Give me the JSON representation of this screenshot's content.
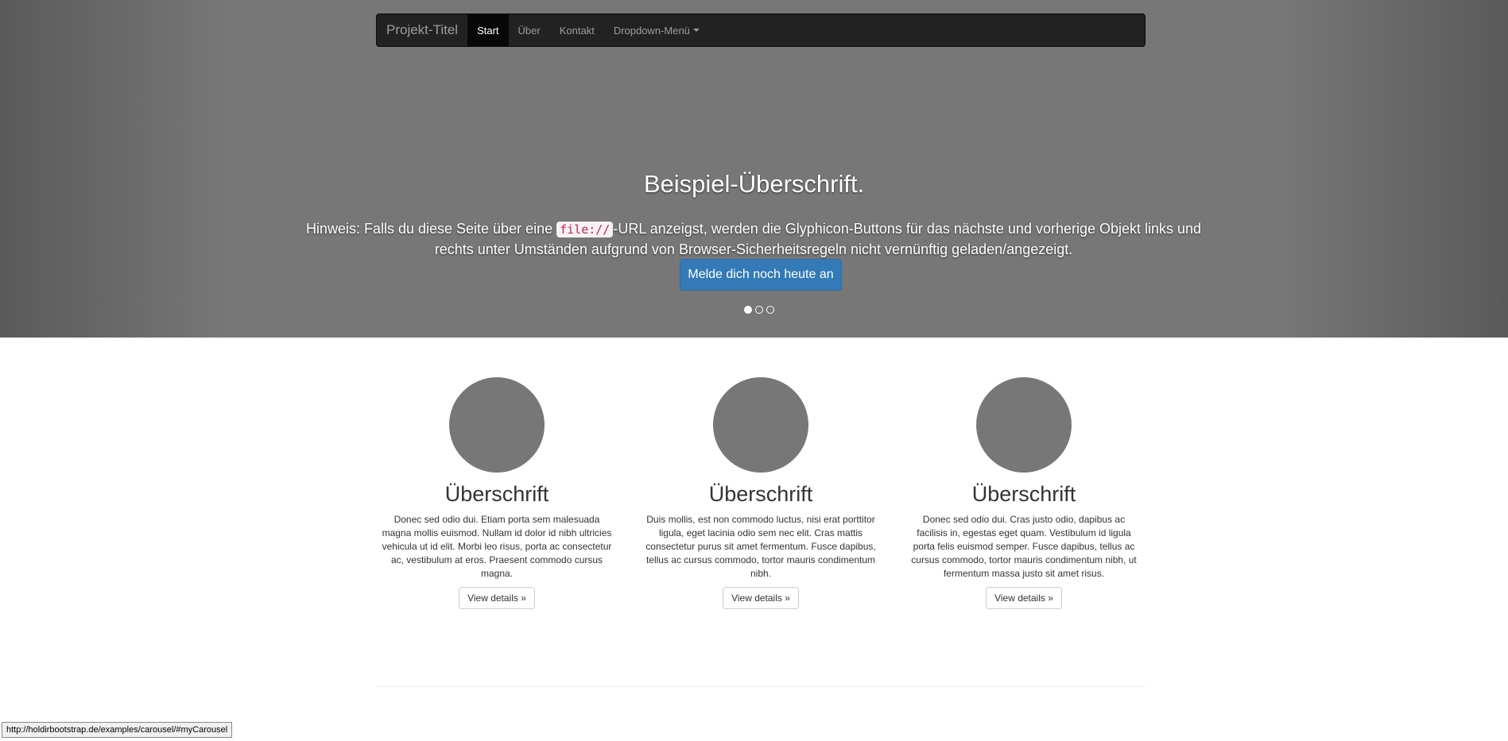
{
  "navbar": {
    "brand": "Projekt-Titel",
    "items": [
      {
        "label": "Start",
        "active": true
      },
      {
        "label": "Über",
        "active": false
      },
      {
        "label": "Kontakt",
        "active": false
      },
      {
        "label": "Dropdown-Menü",
        "active": false
      }
    ]
  },
  "carousel": {
    "title": "Beispiel-Überschrift.",
    "text_before": "Hinweis: Falls du diese Seite über eine ",
    "code": "file://",
    "text_after": "-URL anzeigst, werden die Glyphicon-Buttons für das nächste und vorherige Objekt links und rechts unter Umständen aufgrund von Browser-Sicherheitsregeln nicht vernünftig geladen/angezeigt.",
    "button_label": "Melde dich noch heute an",
    "slide_count": 3,
    "active_slide": 1
  },
  "columns": [
    {
      "heading": "Überschrift",
      "text": "Donec sed odio dui. Etiam porta sem malesuada magna mollis euismod. Nullam id dolor id nibh ultricies vehicula ut id elit. Morbi leo risus, porta ac consectetur ac, vestibulum at eros. Praesent commodo cursus magna.",
      "button_label": "View details »"
    },
    {
      "heading": "Überschrift",
      "text": "Duis mollis, est non commodo luctus, nisi erat porttitor ligula, eget lacinia odio sem nec elit. Cras mattis consectetur purus sit amet fermentum. Fusce dapibus, tellus ac cursus commodo, tortor mauris condimentum nibh.",
      "button_label": "View details »"
    },
    {
      "heading": "Überschrift",
      "text": "Donec sed odio dui. Cras justo odio, dapibus ac facilisis in, egestas eget quam. Vestibulum id ligula porta felis euismod semper. Fusce dapibus, tellus ac cursus commodo, tortor mauris condimentum nibh, ut fermentum massa justo sit amet risus.",
      "button_label": "View details »"
    }
  ],
  "status_bar": {
    "url": "http://holdirbootstrap.de/examples/carousel/#myCarousel"
  }
}
